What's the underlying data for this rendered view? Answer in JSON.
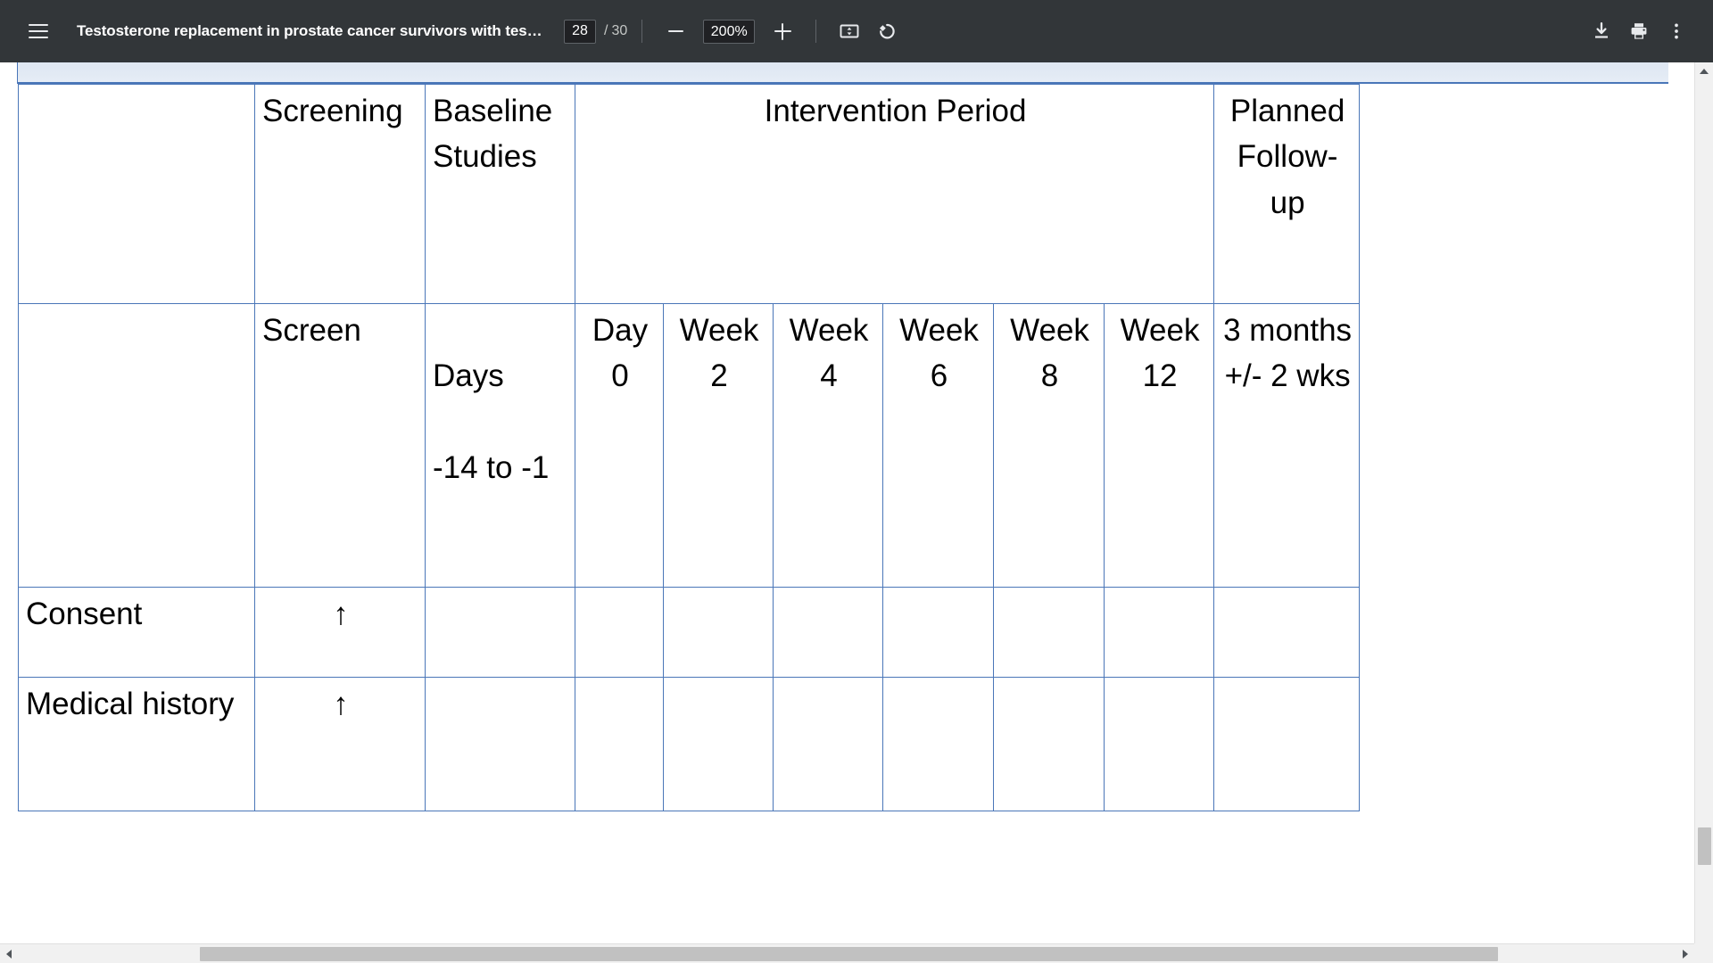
{
  "toolbar": {
    "menu_icon": "hamburger-menu-icon",
    "document_title": "Testosterone replacement in prostate cancer survivors with tes…",
    "page_current": "28",
    "page_total_separator": "/",
    "page_total": "30",
    "zoom_out_icon": "minus-icon",
    "zoom_level": "200%",
    "zoom_in_icon": "plus-icon",
    "fit_page_icon": "fit-to-page-icon",
    "rotate_icon": "rotate-counterclockwise-icon",
    "download_icon": "download-icon",
    "print_icon": "print-icon",
    "more_icon": "more-vertical-icon"
  },
  "colors": {
    "toolbar_bg": "#323639",
    "table_border_blue": "#4a76b8",
    "table_border_black": "#000000",
    "page_strip": "#e2eaf4",
    "scrollbar_thumb": "#c1c1c1"
  },
  "document": {
    "table": {
      "header_row_1": [
        {
          "text": "",
          "colspan": 1
        },
        {
          "text": "Screening",
          "colspan": 1
        },
        {
          "text": "Baseline Studies",
          "colspan": 1
        },
        {
          "text": "Intervention Period",
          "colspan": 6
        },
        {
          "text": "Planned Follow-up",
          "colspan": 1
        }
      ],
      "header_row_2": [
        {
          "text": ""
        },
        {
          "text": "Screen"
        },
        {
          "text": "Days\n\n-14 to -1"
        },
        {
          "text": "Day 0"
        },
        {
          "text": "Week 2"
        },
        {
          "text": "Week 4"
        },
        {
          "text": "Week 6"
        },
        {
          "text": "Week 8"
        },
        {
          "text": "Week 12"
        },
        {
          "text": "3 months +/- 2 wks"
        }
      ],
      "rows": [
        {
          "label": "Consent",
          "cells": [
            "↑",
            "",
            "",
            "",
            "",
            "",
            "",
            "",
            ""
          ]
        },
        {
          "label": "Medical history",
          "cells": [
            "↑",
            "",
            "",
            "",
            "",
            "",
            "",
            "",
            ""
          ]
        }
      ]
    }
  },
  "scrollbars": {
    "vertical_up_icon": "triangle-up-icon",
    "vertical_down_icon": "triangle-down-icon",
    "horizontal_left_icon": "triangle-left-icon",
    "horizontal_right_icon": "triangle-right-icon"
  }
}
